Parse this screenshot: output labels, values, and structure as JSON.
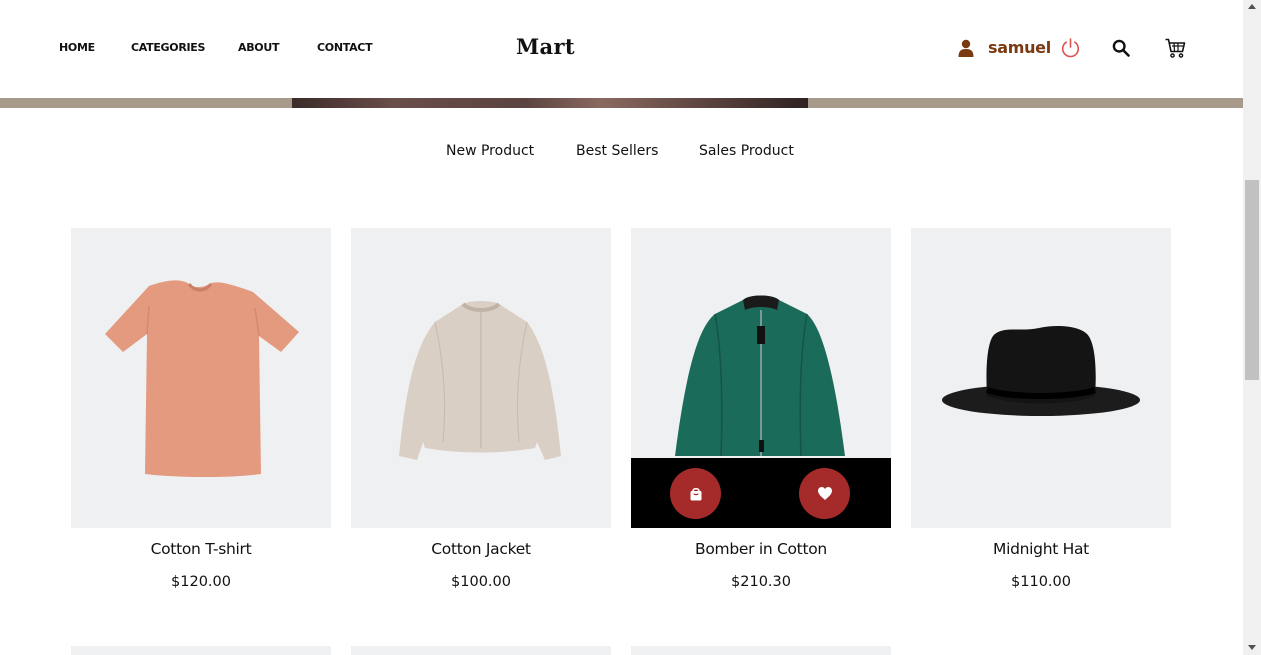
{
  "header": {
    "nav": [
      "HOME",
      "CATEGORIES",
      "ABOUT",
      "CONTACT"
    ],
    "logo": "Mart",
    "username": "samuel",
    "icons": [
      "user-icon",
      "power-icon",
      "search-icon",
      "cart-icon"
    ],
    "accent_color": "#7a3a12",
    "power_color": "#e05050"
  },
  "tabs": [
    "New Product",
    "Best Sellers",
    "Sales Product"
  ],
  "products": [
    {
      "name": "Cotton T-shirt",
      "price": "$120.00",
      "color": "#e39a7f"
    },
    {
      "name": "Cotton Jacket",
      "price": "$100.00",
      "color": "#d9cfc4"
    },
    {
      "name": "Bomber in Cotton",
      "price": "$210.30",
      "color": "#1b6b5a"
    },
    {
      "name": "Midnight Hat",
      "price": "$110.00",
      "color": "#1a1a1a"
    }
  ],
  "overlay": {
    "buttons": [
      "shopping-bag-icon",
      "heart-icon"
    ],
    "button_color": "#a52a2a"
  }
}
